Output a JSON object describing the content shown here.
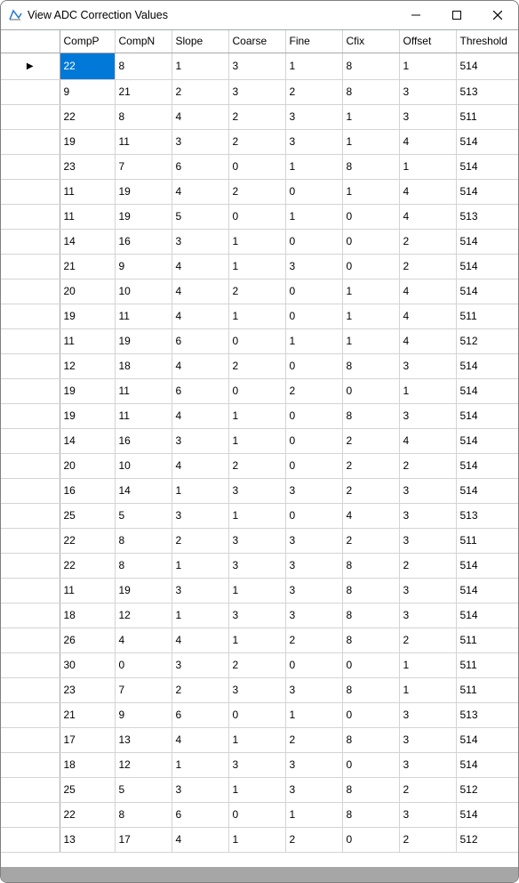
{
  "window": {
    "title": "View ADC Correction Values"
  },
  "grid": {
    "columns": [
      "CompP",
      "CompN",
      "Slope",
      "Coarse",
      "Fine",
      "Cfix",
      "Offset",
      "Threshold"
    ],
    "selected_row": 0,
    "selected_col": 0,
    "rows": [
      [
        "22",
        "8",
        "1",
        "3",
        "1",
        "8",
        "1",
        "514"
      ],
      [
        "9",
        "21",
        "2",
        "3",
        "2",
        "8",
        "3",
        "513"
      ],
      [
        "22",
        "8",
        "4",
        "2",
        "3",
        "1",
        "3",
        "511"
      ],
      [
        "19",
        "11",
        "3",
        "2",
        "3",
        "1",
        "4",
        "514"
      ],
      [
        "23",
        "7",
        "6",
        "0",
        "1",
        "8",
        "1",
        "514"
      ],
      [
        "11",
        "19",
        "4",
        "2",
        "0",
        "1",
        "4",
        "514"
      ],
      [
        "11",
        "19",
        "5",
        "0",
        "1",
        "0",
        "4",
        "513"
      ],
      [
        "14",
        "16",
        "3",
        "1",
        "0",
        "0",
        "2",
        "514"
      ],
      [
        "21",
        "9",
        "4",
        "1",
        "3",
        "0",
        "2",
        "514"
      ],
      [
        "20",
        "10",
        "4",
        "2",
        "0",
        "1",
        "4",
        "514"
      ],
      [
        "19",
        "11",
        "4",
        "1",
        "0",
        "1",
        "4",
        "511"
      ],
      [
        "11",
        "19",
        "6",
        "0",
        "1",
        "1",
        "4",
        "512"
      ],
      [
        "12",
        "18",
        "4",
        "2",
        "0",
        "8",
        "3",
        "514"
      ],
      [
        "19",
        "11",
        "6",
        "0",
        "2",
        "0",
        "1",
        "514"
      ],
      [
        "19",
        "11",
        "4",
        "1",
        "0",
        "8",
        "3",
        "514"
      ],
      [
        "14",
        "16",
        "3",
        "1",
        "0",
        "2",
        "4",
        "514"
      ],
      [
        "20",
        "10",
        "4",
        "2",
        "0",
        "2",
        "2",
        "514"
      ],
      [
        "16",
        "14",
        "1",
        "3",
        "3",
        "2",
        "3",
        "514"
      ],
      [
        "25",
        "5",
        "3",
        "1",
        "0",
        "4",
        "3",
        "513"
      ],
      [
        "22",
        "8",
        "2",
        "3",
        "3",
        "2",
        "3",
        "511"
      ],
      [
        "22",
        "8",
        "1",
        "3",
        "3",
        "8",
        "2",
        "514"
      ],
      [
        "11",
        "19",
        "3",
        "1",
        "3",
        "8",
        "3",
        "514"
      ],
      [
        "18",
        "12",
        "1",
        "3",
        "3",
        "8",
        "3",
        "514"
      ],
      [
        "26",
        "4",
        "4",
        "1",
        "2",
        "8",
        "2",
        "511"
      ],
      [
        "30",
        "0",
        "3",
        "2",
        "0",
        "0",
        "1",
        "511"
      ],
      [
        "23",
        "7",
        "2",
        "3",
        "3",
        "8",
        "1",
        "511"
      ],
      [
        "21",
        "9",
        "6",
        "0",
        "1",
        "0",
        "3",
        "513"
      ],
      [
        "17",
        "13",
        "4",
        "1",
        "2",
        "8",
        "3",
        "514"
      ],
      [
        "18",
        "12",
        "1",
        "3",
        "3",
        "0",
        "3",
        "514"
      ],
      [
        "25",
        "5",
        "3",
        "1",
        "3",
        "8",
        "2",
        "512"
      ],
      [
        "22",
        "8",
        "6",
        "0",
        "1",
        "8",
        "3",
        "514"
      ],
      [
        "13",
        "17",
        "4",
        "1",
        "2",
        "0",
        "2",
        "512"
      ]
    ]
  }
}
